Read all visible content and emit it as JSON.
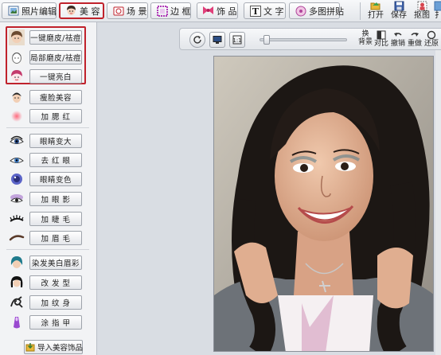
{
  "toolbar": {
    "tabs": [
      {
        "label": "照片编辑",
        "icon": "photo-edit-icon"
      },
      {
        "label": "美 容",
        "icon": "beauty-face-icon",
        "active": true
      },
      {
        "label": "场 景",
        "icon": "scene-icon"
      },
      {
        "label": "边 框",
        "icon": "frame-icon"
      },
      {
        "label": "饰 品",
        "icon": "accessory-icon"
      },
      {
        "label": "文 字",
        "icon": "text-icon"
      },
      {
        "label": "多图拼贴",
        "icon": "collage-icon"
      }
    ],
    "actions": [
      {
        "label": "打开",
        "icon": "open-folder-icon"
      },
      {
        "label": "保存",
        "icon": "save-icon"
      },
      {
        "label": "抠图",
        "icon": "cutout-icon"
      },
      {
        "label": "扌",
        "icon": "more-icon"
      }
    ],
    "accent": "#c0222c"
  },
  "beauty_panel": {
    "items": [
      {
        "label": "一键磨皮/祛痘",
        "icon": "face-thumb-icon"
      },
      {
        "label": "局部磨皮/祛痘",
        "icon": "face-sketch-icon"
      },
      {
        "label": "一键亮白",
        "icon": "face-white-icon"
      },
      {
        "label": "瘦脸美容",
        "icon": "slim-face-icon"
      },
      {
        "label": "加 腮 红",
        "icon": "blush-icon"
      },
      {
        "label": "眼睛变大",
        "icon": "eye-enlarge-icon"
      },
      {
        "label": "去 红 眼",
        "icon": "red-eye-icon"
      },
      {
        "label": "眼睛变色",
        "icon": "eye-color-icon"
      },
      {
        "label": "加 眼 影",
        "icon": "eye-shadow-icon"
      },
      {
        "label": "加 睫 毛",
        "icon": "eyelash-icon"
      },
      {
        "label": "加 眉 毛",
        "icon": "eyebrow-icon"
      },
      {
        "label": "染发美白眉彩",
        "icon": "hair-dye-icon"
      },
      {
        "label": "改 发 型",
        "icon": "hairstyle-icon"
      },
      {
        "label": "加 纹 身",
        "icon": "tattoo-icon"
      },
      {
        "label": "涂 指 甲",
        "icon": "nail-polish-icon"
      }
    ],
    "import_label": "导入美容饰品"
  },
  "view_bar": {
    "zoom_level": 0.04,
    "tools": [
      {
        "label": "换\n背景",
        "icon": "swap-background-icon"
      },
      {
        "label": "对比",
        "icon": "compare-icon"
      },
      {
        "label": "撤销",
        "icon": "undo-icon"
      },
      {
        "label": "重做",
        "icon": "redo-icon"
      },
      {
        "label": "还原",
        "icon": "restore-icon"
      }
    ]
  }
}
